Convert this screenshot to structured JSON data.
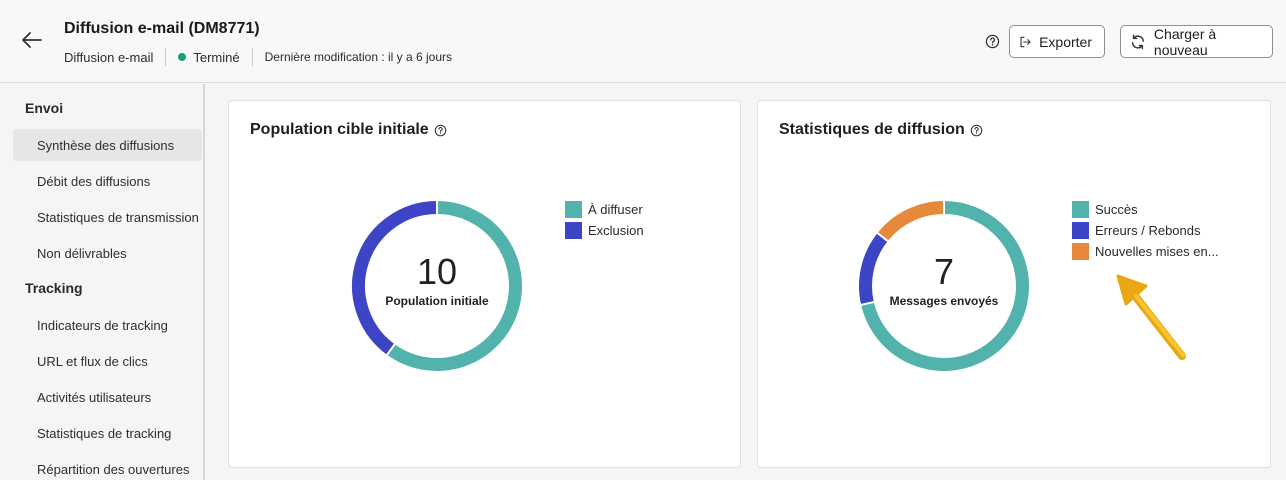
{
  "header": {
    "title": "Diffusion e-mail (DM8771)",
    "type": "Diffusion e-mail",
    "status": "Terminé",
    "last_modified": "Dernière modification : il y a 6 jours",
    "export_label": "Exporter",
    "reload_label": "Charger à nouveau",
    "status_color": "#12a26b"
  },
  "sidebar": {
    "sections": [
      {
        "title": "Envoi",
        "items": [
          {
            "label": "Synthèse des diffusions",
            "active": true
          },
          {
            "label": "Débit des diffusions"
          },
          {
            "label": "Statistiques de transmission"
          },
          {
            "label": "Non délivrables"
          }
        ]
      },
      {
        "title": "Tracking",
        "items": [
          {
            "label": "Indicateurs de tracking"
          },
          {
            "label": "URL et flux de clics"
          },
          {
            "label": "Activités utilisateurs"
          },
          {
            "label": "Statistiques de tracking"
          },
          {
            "label": "Répartition des ouvertures"
          }
        ]
      }
    ]
  },
  "cards": {
    "left": {
      "title": "Population cible initiale",
      "value": "10",
      "center_label": "Population initiale"
    },
    "right": {
      "title": "Statistiques de diffusion",
      "value": "7",
      "center_label": "Messages envoyés"
    }
  },
  "chart_data": [
    {
      "type": "pie",
      "total": 10,
      "series": [
        {
          "name": "À diffuser",
          "value": 6,
          "color": "#52b3ad"
        },
        {
          "name": "Exclusion",
          "value": 4,
          "color": "#3d44c6"
        }
      ]
    },
    {
      "type": "pie",
      "total": 7,
      "series": [
        {
          "name": "Succès",
          "value": 5,
          "color": "#52b3ad"
        },
        {
          "name": "Erreurs  / Rebonds",
          "value": 1,
          "color": "#3d44c6"
        },
        {
          "name": "Nouvelles mises en...",
          "value": 1,
          "color": "#e6893b"
        }
      ]
    }
  ]
}
